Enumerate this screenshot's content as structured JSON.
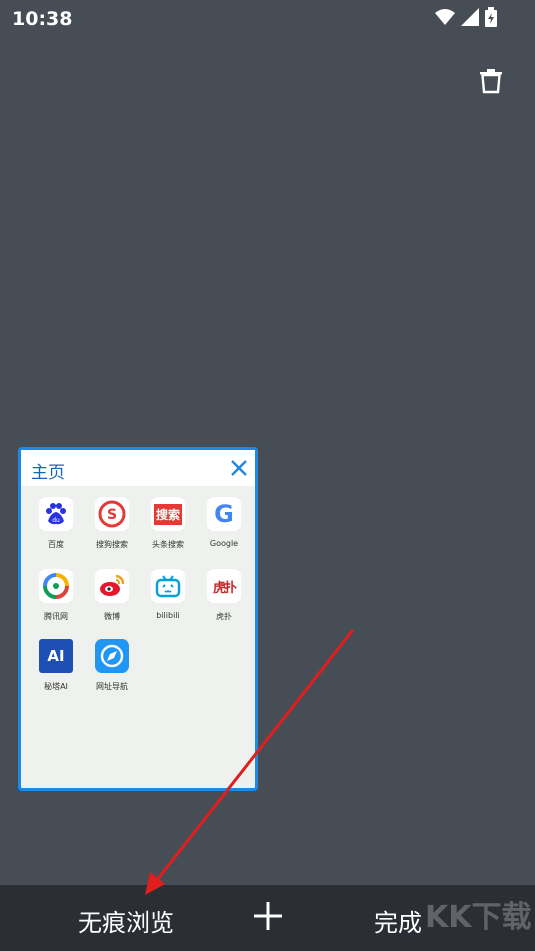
{
  "status_bar": {
    "time": "10:38",
    "icons": [
      "wifi-icon",
      "signal-icon",
      "battery-charging-icon"
    ]
  },
  "toolbar": {
    "trash_icon": "trash-icon"
  },
  "tab_card": {
    "title": "主页",
    "close_icon": "close-icon",
    "shortcuts": [
      {
        "label": "百度",
        "icon": "baidu-icon"
      },
      {
        "label": "搜狗搜索",
        "icon": "sogou-icon"
      },
      {
        "label": "头条搜索",
        "icon": "toutiao-icon",
        "icon_text": "搜索"
      },
      {
        "label": "Google",
        "icon": "google-icon",
        "icon_text": "G"
      },
      {
        "label": "腾讯网",
        "icon": "tencent-icon"
      },
      {
        "label": "微博",
        "icon": "weibo-icon"
      },
      {
        "label": "bilibili",
        "icon": "bilibili-icon"
      },
      {
        "label": "虎扑",
        "icon": "hupu-icon",
        "icon_text": "虎扑"
      },
      {
        "label": "秘塔AI",
        "icon": "metaso-icon",
        "icon_text": "AI"
      },
      {
        "label": "网址导航",
        "icon": "compass-icon"
      }
    ]
  },
  "bottom_bar": {
    "incognito_label": "无痕浏览",
    "add_tab_icon": "plus-icon",
    "done_label": "完成"
  },
  "watermark": "KK下载",
  "colors": {
    "accent": "#1e88e5",
    "background": "#474d55",
    "bottom_bar": "#2b2f35",
    "annotation_arrow": "#e01e1e"
  }
}
